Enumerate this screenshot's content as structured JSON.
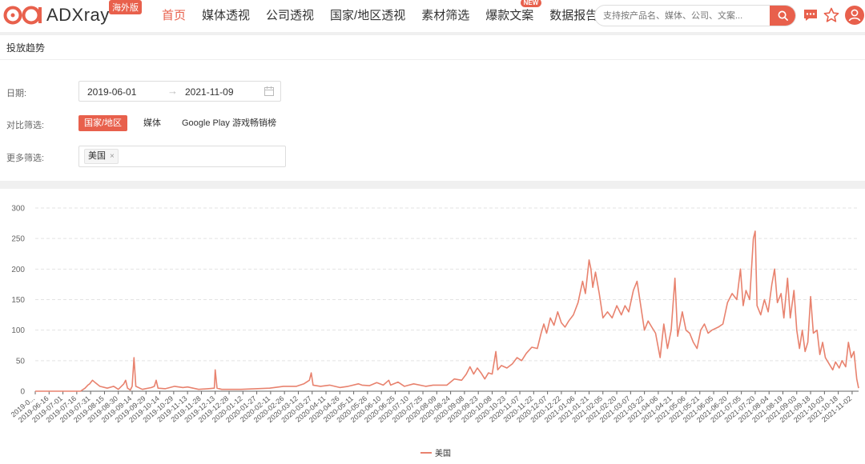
{
  "header": {
    "logo_text": "ADXray",
    "logo_badge": "海外版",
    "nav": [
      {
        "label": "首页",
        "active": true
      },
      {
        "label": "媒体透视"
      },
      {
        "label": "公司透视"
      },
      {
        "label": "国家/地区透视"
      },
      {
        "label": "素材筛选"
      },
      {
        "label": "爆款文案",
        "badge": "NEW"
      },
      {
        "label": "数据报告"
      }
    ],
    "search_placeholder": "支持按产品名、媒体、公司、文案...",
    "icons": [
      "message-icon",
      "star-icon",
      "user-icon"
    ]
  },
  "filters": {
    "section_title": "投放趋势",
    "date_label": "日期:",
    "date_start": "2019-06-01",
    "date_end": "2021-11-09",
    "compare_label": "对比筛选:",
    "compare_options": [
      {
        "label": "国家/地区",
        "active": true
      },
      {
        "label": "媒体"
      },
      {
        "label": "Google Play 游戏畅销榜"
      }
    ],
    "more_label": "更多筛选:",
    "tags": [
      {
        "label": "美国",
        "remove": "×"
      }
    ]
  },
  "colors": {
    "accent": "#e8604c",
    "series": "#e8826e"
  },
  "chart_data": {
    "type": "line",
    "yticks": [
      0,
      50,
      100,
      150,
      200,
      250,
      300
    ],
    "ylim": [
      0,
      300
    ],
    "xlim": [
      "2019-06-01",
      "2021-11-09"
    ],
    "xticks": [
      "2019-0...",
      "2019-06-16",
      "2019-07-01",
      "2019-07-16",
      "2019-07-31",
      "2019-08-15",
      "2019-08-30",
      "2019-09-14",
      "2019-09-29",
      "2019-10-14",
      "2019-10-29",
      "2019-11-13",
      "2019-11-28",
      "2019-12-13",
      "2019-12-28",
      "2020-01-12",
      "2020-01-27",
      "2020-02-11",
      "2020-02-26",
      "2020-03-12",
      "2020-03-27",
      "2020-04-11",
      "2020-04-26",
      "2020-05-11",
      "2020-05-26",
      "2020-06-10",
      "2020-06-25",
      "2020-07-10",
      "2020-07-25",
      "2020-08-09",
      "2020-08-24",
      "2020-09-08",
      "2020-09-23",
      "2020-10-08",
      "2020-10-23",
      "2020-11-07",
      "2020-11-22",
      "2020-12-07",
      "2020-12-22",
      "2021-01-06",
      "2021-01-21",
      "2021-02-05",
      "2021-02-20",
      "2021-03-07",
      "2021-03-22",
      "2021-04-06",
      "2021-04-21",
      "2021-05-06",
      "2021-05-21",
      "2021-06-05",
      "2021-06-20",
      "2021-07-05",
      "2021-07-20",
      "2021-08-04",
      "2021-08-19",
      "2021-09-03",
      "2021-09-18",
      "2021-10-03",
      "2021-10-18",
      "2021-11-02"
    ],
    "legend": "bottom-center",
    "grid": true,
    "series": [
      {
        "name": "美国",
        "points": [
          [
            "2019-06-01",
            0
          ],
          [
            "2019-07-20",
            0
          ],
          [
            "2019-07-25",
            5
          ],
          [
            "2019-07-28",
            10
          ],
          [
            "2019-07-30",
            12
          ],
          [
            "2019-08-02",
            18
          ],
          [
            "2019-08-05",
            14
          ],
          [
            "2019-08-10",
            8
          ],
          [
            "2019-08-18",
            5
          ],
          [
            "2019-08-25",
            8
          ],
          [
            "2019-08-30",
            3
          ],
          [
            "2019-09-05",
            12
          ],
          [
            "2019-09-07",
            18
          ],
          [
            "2019-09-09",
            5
          ],
          [
            "2019-09-12",
            2
          ],
          [
            "2019-09-14",
            8
          ],
          [
            "2019-09-16",
            55
          ],
          [
            "2019-09-18",
            8
          ],
          [
            "2019-09-25",
            3
          ],
          [
            "2019-10-05",
            6
          ],
          [
            "2019-10-08",
            8
          ],
          [
            "2019-10-10",
            18
          ],
          [
            "2019-10-12",
            5
          ],
          [
            "2019-10-20",
            4
          ],
          [
            "2019-10-30",
            8
          ],
          [
            "2019-11-08",
            6
          ],
          [
            "2019-11-13",
            7
          ],
          [
            "2019-11-25",
            3
          ],
          [
            "2019-12-05",
            4
          ],
          [
            "2019-12-12",
            5
          ],
          [
            "2019-12-13",
            35
          ],
          [
            "2019-12-15",
            5
          ],
          [
            "2019-12-20",
            3
          ],
          [
            "2020-01-10",
            3
          ],
          [
            "2020-02-10",
            5
          ],
          [
            "2020-02-25",
            8
          ],
          [
            "2020-03-10",
            8
          ],
          [
            "2020-03-18",
            12
          ],
          [
            "2020-03-24",
            18
          ],
          [
            "2020-03-26",
            30
          ],
          [
            "2020-03-28",
            10
          ],
          [
            "2020-04-05",
            8
          ],
          [
            "2020-04-15",
            10
          ],
          [
            "2020-04-26",
            6
          ],
          [
            "2020-05-05",
            8
          ],
          [
            "2020-05-16",
            12
          ],
          [
            "2020-05-20",
            10
          ],
          [
            "2020-05-28",
            9
          ],
          [
            "2020-06-05",
            14
          ],
          [
            "2020-06-12",
            10
          ],
          [
            "2020-06-18",
            18
          ],
          [
            "2020-06-20",
            10
          ],
          [
            "2020-06-28",
            15
          ],
          [
            "2020-07-05",
            8
          ],
          [
            "2020-07-15",
            12
          ],
          [
            "2020-07-28",
            8
          ],
          [
            "2020-08-05",
            10
          ],
          [
            "2020-08-20",
            10
          ],
          [
            "2020-08-28",
            20
          ],
          [
            "2020-09-05",
            18
          ],
          [
            "2020-09-10",
            28
          ],
          [
            "2020-09-14",
            40
          ],
          [
            "2020-09-18",
            28
          ],
          [
            "2020-09-22",
            38
          ],
          [
            "2020-09-26",
            30
          ],
          [
            "2020-09-30",
            20
          ],
          [
            "2020-10-04",
            30
          ],
          [
            "2020-10-08",
            28
          ],
          [
            "2020-10-12",
            65
          ],
          [
            "2020-10-14",
            35
          ],
          [
            "2020-10-18",
            42
          ],
          [
            "2020-10-24",
            38
          ],
          [
            "2020-10-30",
            45
          ],
          [
            "2020-11-04",
            55
          ],
          [
            "2020-11-09",
            50
          ],
          [
            "2020-11-14",
            62
          ],
          [
            "2020-11-20",
            72
          ],
          [
            "2020-11-26",
            70
          ],
          [
            "2020-11-30",
            95
          ],
          [
            "2020-12-03",
            110
          ],
          [
            "2020-12-06",
            95
          ],
          [
            "2020-12-10",
            120
          ],
          [
            "2020-12-14",
            108
          ],
          [
            "2020-12-18",
            130
          ],
          [
            "2020-12-22",
            112
          ],
          [
            "2020-12-26",
            105
          ],
          [
            "2020-12-30",
            115
          ],
          [
            "2021-01-04",
            125
          ],
          [
            "2021-01-09",
            145
          ],
          [
            "2021-01-14",
            180
          ],
          [
            "2021-01-17",
            160
          ],
          [
            "2021-01-21",
            215
          ],
          [
            "2021-01-23",
            200
          ],
          [
            "2021-01-25",
            170
          ],
          [
            "2021-01-28",
            195
          ],
          [
            "2021-02-01",
            160
          ],
          [
            "2021-02-05",
            120
          ],
          [
            "2021-02-10",
            130
          ],
          [
            "2021-02-15",
            120
          ],
          [
            "2021-02-20",
            140
          ],
          [
            "2021-02-25",
            125
          ],
          [
            "2021-03-01",
            140
          ],
          [
            "2021-03-05",
            130
          ],
          [
            "2021-03-10",
            165
          ],
          [
            "2021-03-14",
            180
          ],
          [
            "2021-03-18",
            140
          ],
          [
            "2021-03-22",
            100
          ],
          [
            "2021-03-26",
            115
          ],
          [
            "2021-03-30",
            105
          ],
          [
            "2021-04-03",
            95
          ],
          [
            "2021-04-08",
            55
          ],
          [
            "2021-04-12",
            110
          ],
          [
            "2021-04-16",
            70
          ],
          [
            "2021-04-20",
            100
          ],
          [
            "2021-04-24",
            185
          ],
          [
            "2021-04-27",
            90
          ],
          [
            "2021-05-02",
            130
          ],
          [
            "2021-05-06",
            100
          ],
          [
            "2021-05-10",
            95
          ],
          [
            "2021-05-14",
            80
          ],
          [
            "2021-05-18",
            70
          ],
          [
            "2021-05-22",
            100
          ],
          [
            "2021-05-26",
            110
          ],
          [
            "2021-05-30",
            95
          ],
          [
            "2021-06-03",
            100
          ],
          [
            "2021-06-10",
            105
          ],
          [
            "2021-06-15",
            110
          ],
          [
            "2021-06-20",
            145
          ],
          [
            "2021-06-25",
            160
          ],
          [
            "2021-06-30",
            150
          ],
          [
            "2021-07-04",
            200
          ],
          [
            "2021-07-07",
            140
          ],
          [
            "2021-07-10",
            165
          ],
          [
            "2021-07-14",
            150
          ],
          [
            "2021-07-18",
            250
          ],
          [
            "2021-07-20",
            262
          ],
          [
            "2021-07-22",
            140
          ],
          [
            "2021-07-26",
            125
          ],
          [
            "2021-07-30",
            150
          ],
          [
            "2021-08-03",
            130
          ],
          [
            "2021-08-07",
            175
          ],
          [
            "2021-08-10",
            200
          ],
          [
            "2021-08-13",
            145
          ],
          [
            "2021-08-17",
            160
          ],
          [
            "2021-08-20",
            120
          ],
          [
            "2021-08-24",
            185
          ],
          [
            "2021-08-27",
            120
          ],
          [
            "2021-08-31",
            165
          ],
          [
            "2021-09-03",
            100
          ],
          [
            "2021-09-06",
            70
          ],
          [
            "2021-09-09",
            100
          ],
          [
            "2021-09-12",
            65
          ],
          [
            "2021-09-15",
            80
          ],
          [
            "2021-09-18",
            155
          ],
          [
            "2021-09-21",
            95
          ],
          [
            "2021-09-25",
            100
          ],
          [
            "2021-09-28",
            60
          ],
          [
            "2021-10-01",
            80
          ],
          [
            "2021-10-04",
            55
          ],
          [
            "2021-10-08",
            45
          ],
          [
            "2021-10-12",
            35
          ],
          [
            "2021-10-15",
            48
          ],
          [
            "2021-10-19",
            38
          ],
          [
            "2021-10-22",
            50
          ],
          [
            "2021-10-26",
            40
          ],
          [
            "2021-10-29",
            80
          ],
          [
            "2021-11-01",
            55
          ],
          [
            "2021-11-04",
            65
          ],
          [
            "2021-11-07",
            20
          ],
          [
            "2021-11-09",
            5
          ]
        ]
      }
    ]
  }
}
